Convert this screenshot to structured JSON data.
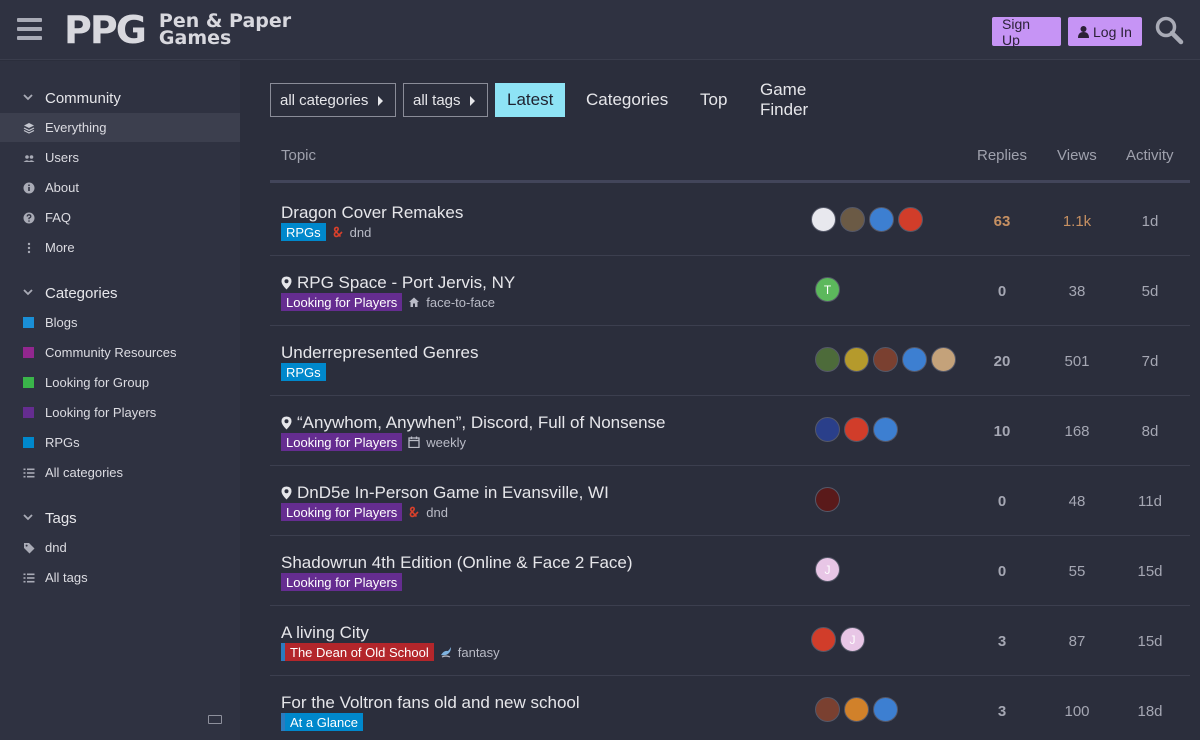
{
  "header": {
    "logo_mark": "PPG",
    "logo_line1": "Pen & Paper",
    "logo_line2": "Games",
    "signup": "Sign Up",
    "login": "Log In"
  },
  "sidebar": {
    "community": {
      "title": "Community",
      "items": [
        {
          "label": "Everything",
          "icon": "layers-icon"
        },
        {
          "label": "Users",
          "icon": "users-icon"
        },
        {
          "label": "About",
          "icon": "info-icon"
        },
        {
          "label": "FAQ",
          "icon": "question-icon"
        },
        {
          "label": "More",
          "icon": "ellipsis-vertical-icon"
        }
      ]
    },
    "categories": {
      "title": "Categories",
      "items": [
        {
          "label": "Blogs",
          "color": "#1a8fd6"
        },
        {
          "label": "Community Resources",
          "color": "#92278f"
        },
        {
          "label": "Looking for Group",
          "color": "#3ab54a"
        },
        {
          "label": "Looking for Players",
          "color": "#652d90"
        },
        {
          "label": "RPGs",
          "color": "#0088cc"
        },
        {
          "label": "All categories",
          "icon": "list-icon"
        }
      ]
    },
    "tags": {
      "title": "Tags",
      "items": [
        {
          "label": "dnd",
          "icon": "tag-icon"
        },
        {
          "label": "All tags",
          "icon": "list-icon"
        }
      ]
    }
  },
  "nav": {
    "all_categories": "all categories",
    "all_tags": "all tags",
    "tabs": [
      "Latest",
      "Categories",
      "Top",
      "Game Finder"
    ]
  },
  "table": {
    "headers": {
      "topic": "Topic",
      "replies": "Replies",
      "views": "Views",
      "activity": "Activity"
    },
    "rows": [
      {
        "title": "Dragon Cover Remakes",
        "pinned": false,
        "category": "RPGs",
        "category_color": "#0088cc",
        "tag": "dnd",
        "tag_icon": "dnd-ampersand-icon",
        "replies": "63",
        "views": "1.1k",
        "activity": "1d",
        "hot": true,
        "posters": [
          {
            "bg": "#e8e8ee"
          },
          {
            "bg": "#6b5a45"
          },
          {
            "bg": "#3d7fd1"
          },
          {
            "bg": "#d13d2a"
          }
        ]
      },
      {
        "title": "RPG Space - Port Jervis, NY",
        "pinned": true,
        "category": "Looking for Players",
        "category_color": "#652d90",
        "tag": "face-to-face",
        "tag_icon": "house-icon",
        "replies": "0",
        "views": "38",
        "activity": "5d",
        "hot": false,
        "posters": [
          {
            "bg": "#5cb85c",
            "letter": "T"
          }
        ]
      },
      {
        "title": "Underrepresented Genres",
        "pinned": false,
        "category": "RPGs",
        "category_color": "#0088cc",
        "tag": "",
        "tag_icon": "",
        "replies": "20",
        "views": "501",
        "activity": "7d",
        "hot": false,
        "posters": [
          {
            "bg": "#4d6b3a"
          },
          {
            "bg": "#b59a2c"
          },
          {
            "bg": "#7a4030"
          },
          {
            "bg": "#3d7fd1"
          },
          {
            "bg": "#c4a27a"
          }
        ]
      },
      {
        "title": "“Anywhom, Anywhen”, Discord, Full of Nonsense",
        "pinned": true,
        "category": "Looking for Players",
        "category_color": "#652d90",
        "tag": "weekly",
        "tag_icon": "calendar-icon",
        "replies": "10",
        "views": "168",
        "activity": "8d",
        "hot": false,
        "posters": [
          {
            "bg": "#2a3f8a"
          },
          {
            "bg": "#d13d2a"
          },
          {
            "bg": "#3d7fd1"
          }
        ]
      },
      {
        "title": "DnD5e In-Person Game in Evansville, WI",
        "pinned": true,
        "category": "Looking for Players",
        "category_color": "#652d90",
        "tag": "dnd",
        "tag_icon": "dnd-ampersand-icon",
        "replies": "0",
        "views": "48",
        "activity": "11d",
        "hot": false,
        "posters": [
          {
            "bg": "#5a1a1a"
          }
        ]
      },
      {
        "title": "Shadowrun 4th Edition (Online & Face 2 Face)",
        "pinned": false,
        "category": "Looking for Players",
        "category_color": "#652d90",
        "tag": "",
        "tag_icon": "",
        "replies": "0",
        "views": "55",
        "activity": "15d",
        "hot": false,
        "posters": [
          {
            "bg": "#e8c6e6",
            "letter": "J"
          }
        ]
      },
      {
        "title": "A living City",
        "pinned": false,
        "category": "The Dean of Old School",
        "category_color": "#b3262b",
        "tag": "fantasy",
        "tag_icon": "dragon-icon",
        "replies": "3",
        "views": "87",
        "activity": "15d",
        "hot": false,
        "strip": true,
        "posters": [
          {
            "bg": "#d13d2a"
          },
          {
            "bg": "#e8c6e6",
            "letter": "J"
          }
        ]
      },
      {
        "title": "For the Voltron fans old and new school",
        "pinned": false,
        "category": "At a Glance",
        "category_color": "#0088cc",
        "tag": "",
        "tag_icon": "",
        "replies": "3",
        "views": "100",
        "activity": "18d",
        "hot": false,
        "strip": true,
        "posters": [
          {
            "bg": "#7a4030"
          },
          {
            "bg": "#d1812a"
          },
          {
            "bg": "#3d7fd1"
          }
        ]
      }
    ]
  }
}
